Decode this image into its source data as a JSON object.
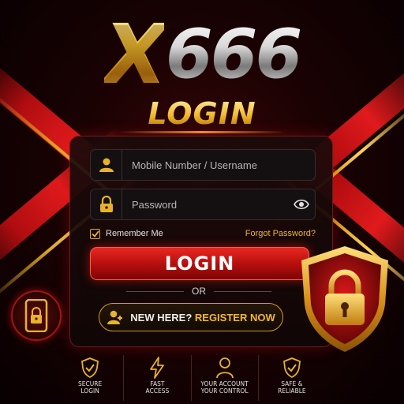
{
  "brand": {
    "logo_x": "X",
    "logo_number": "666",
    "subtitle": "LOGIN"
  },
  "form": {
    "username": {
      "placeholder": "Mobile Number / Username",
      "icon": "user-icon"
    },
    "password": {
      "placeholder": "Password",
      "icon": "lock-icon",
      "toggle_icon": "eye-icon"
    },
    "remember_label": "Remember Me",
    "remember_checked": true,
    "forgot_label": "Forgot Password?",
    "login_label": "LOGIN",
    "divider_label": "OR",
    "register_prefix": "NEW HERE?",
    "register_action": "REGISTER NOW"
  },
  "features": [
    {
      "icon": "shield-check-icon",
      "line1": "SECURE",
      "line2": "LOGIN"
    },
    {
      "icon": "lightning-icon",
      "line1": "FAST",
      "line2": "ACCESS"
    },
    {
      "icon": "user-icon",
      "line1": "YOUR ACCOUNT",
      "line2": "YOUR CONTROL"
    },
    {
      "icon": "shield-check-icon",
      "line1": "SAFE &",
      "line2": "RELIABLE"
    }
  ],
  "colors": {
    "accent_gold": "#f2b92a",
    "accent_red": "#d61a16",
    "background": "#1a0203"
  }
}
